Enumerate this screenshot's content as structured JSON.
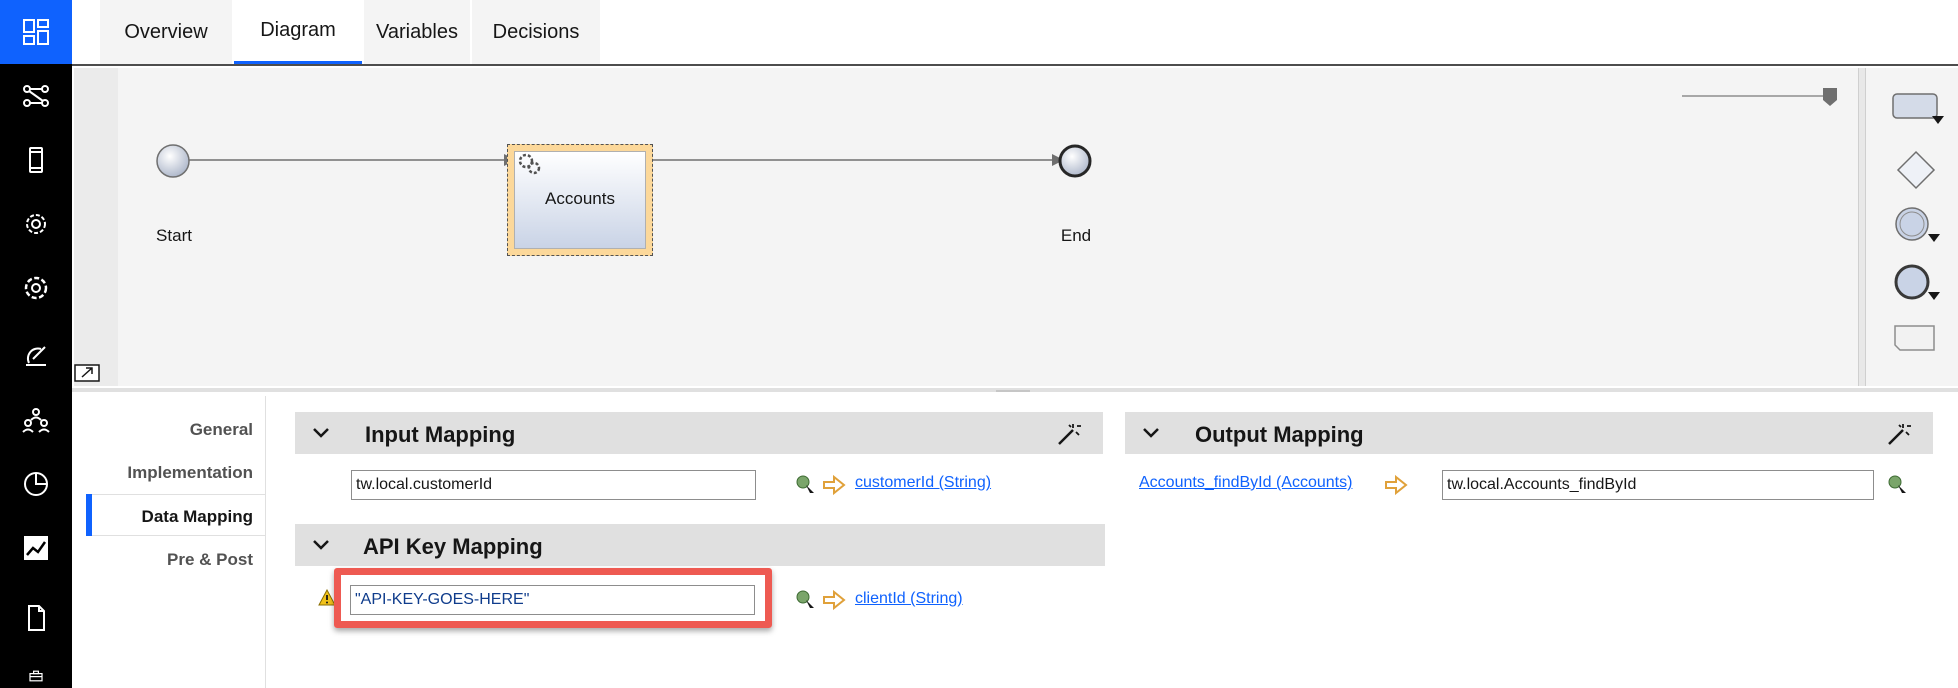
{
  "tabs": [
    {
      "label": "Overview"
    },
    {
      "label": "Diagram"
    },
    {
      "label": "Variables"
    },
    {
      "label": "Decisions"
    }
  ],
  "rail": {
    "items": [
      "dashboard-icon",
      "workflow-icon",
      "mobile-icon",
      "automation-settings-icon",
      "settings-icon",
      "satellite-icon",
      "users-icon",
      "pie-chart-icon",
      "trend-chart-icon",
      "document-icon",
      "toolbox-icon"
    ],
    "accent": "#0f62fe"
  },
  "diagram": {
    "start_label": "Start",
    "task_label": "Accounts",
    "end_label": "End"
  },
  "palette": {
    "items": [
      "activity-tool-icon",
      "gateway-tool-icon",
      "intermediate-event-tool-icon",
      "end-event-tool-icon",
      "note-tool-icon"
    ]
  },
  "props_nav": {
    "items": [
      {
        "label": "General"
      },
      {
        "label": "Implementation"
      },
      {
        "label": "Data Mapping"
      },
      {
        "label": "Pre & Post"
      }
    ],
    "active": "Data Mapping"
  },
  "input_mapping": {
    "title": "Input Mapping",
    "field_value": "tw.local.customerId",
    "link": "customerId (String)"
  },
  "api_key_mapping": {
    "title": "API Key Mapping",
    "field_value": "\"API-KEY-GOES-HERE\"",
    "link": "clientId (String)",
    "highlight_color": "#ee5a52"
  },
  "output_mapping": {
    "title": "Output Mapping",
    "link": "Accounts_findById (Accounts)",
    "field_value": "tw.local.Accounts_findById"
  }
}
